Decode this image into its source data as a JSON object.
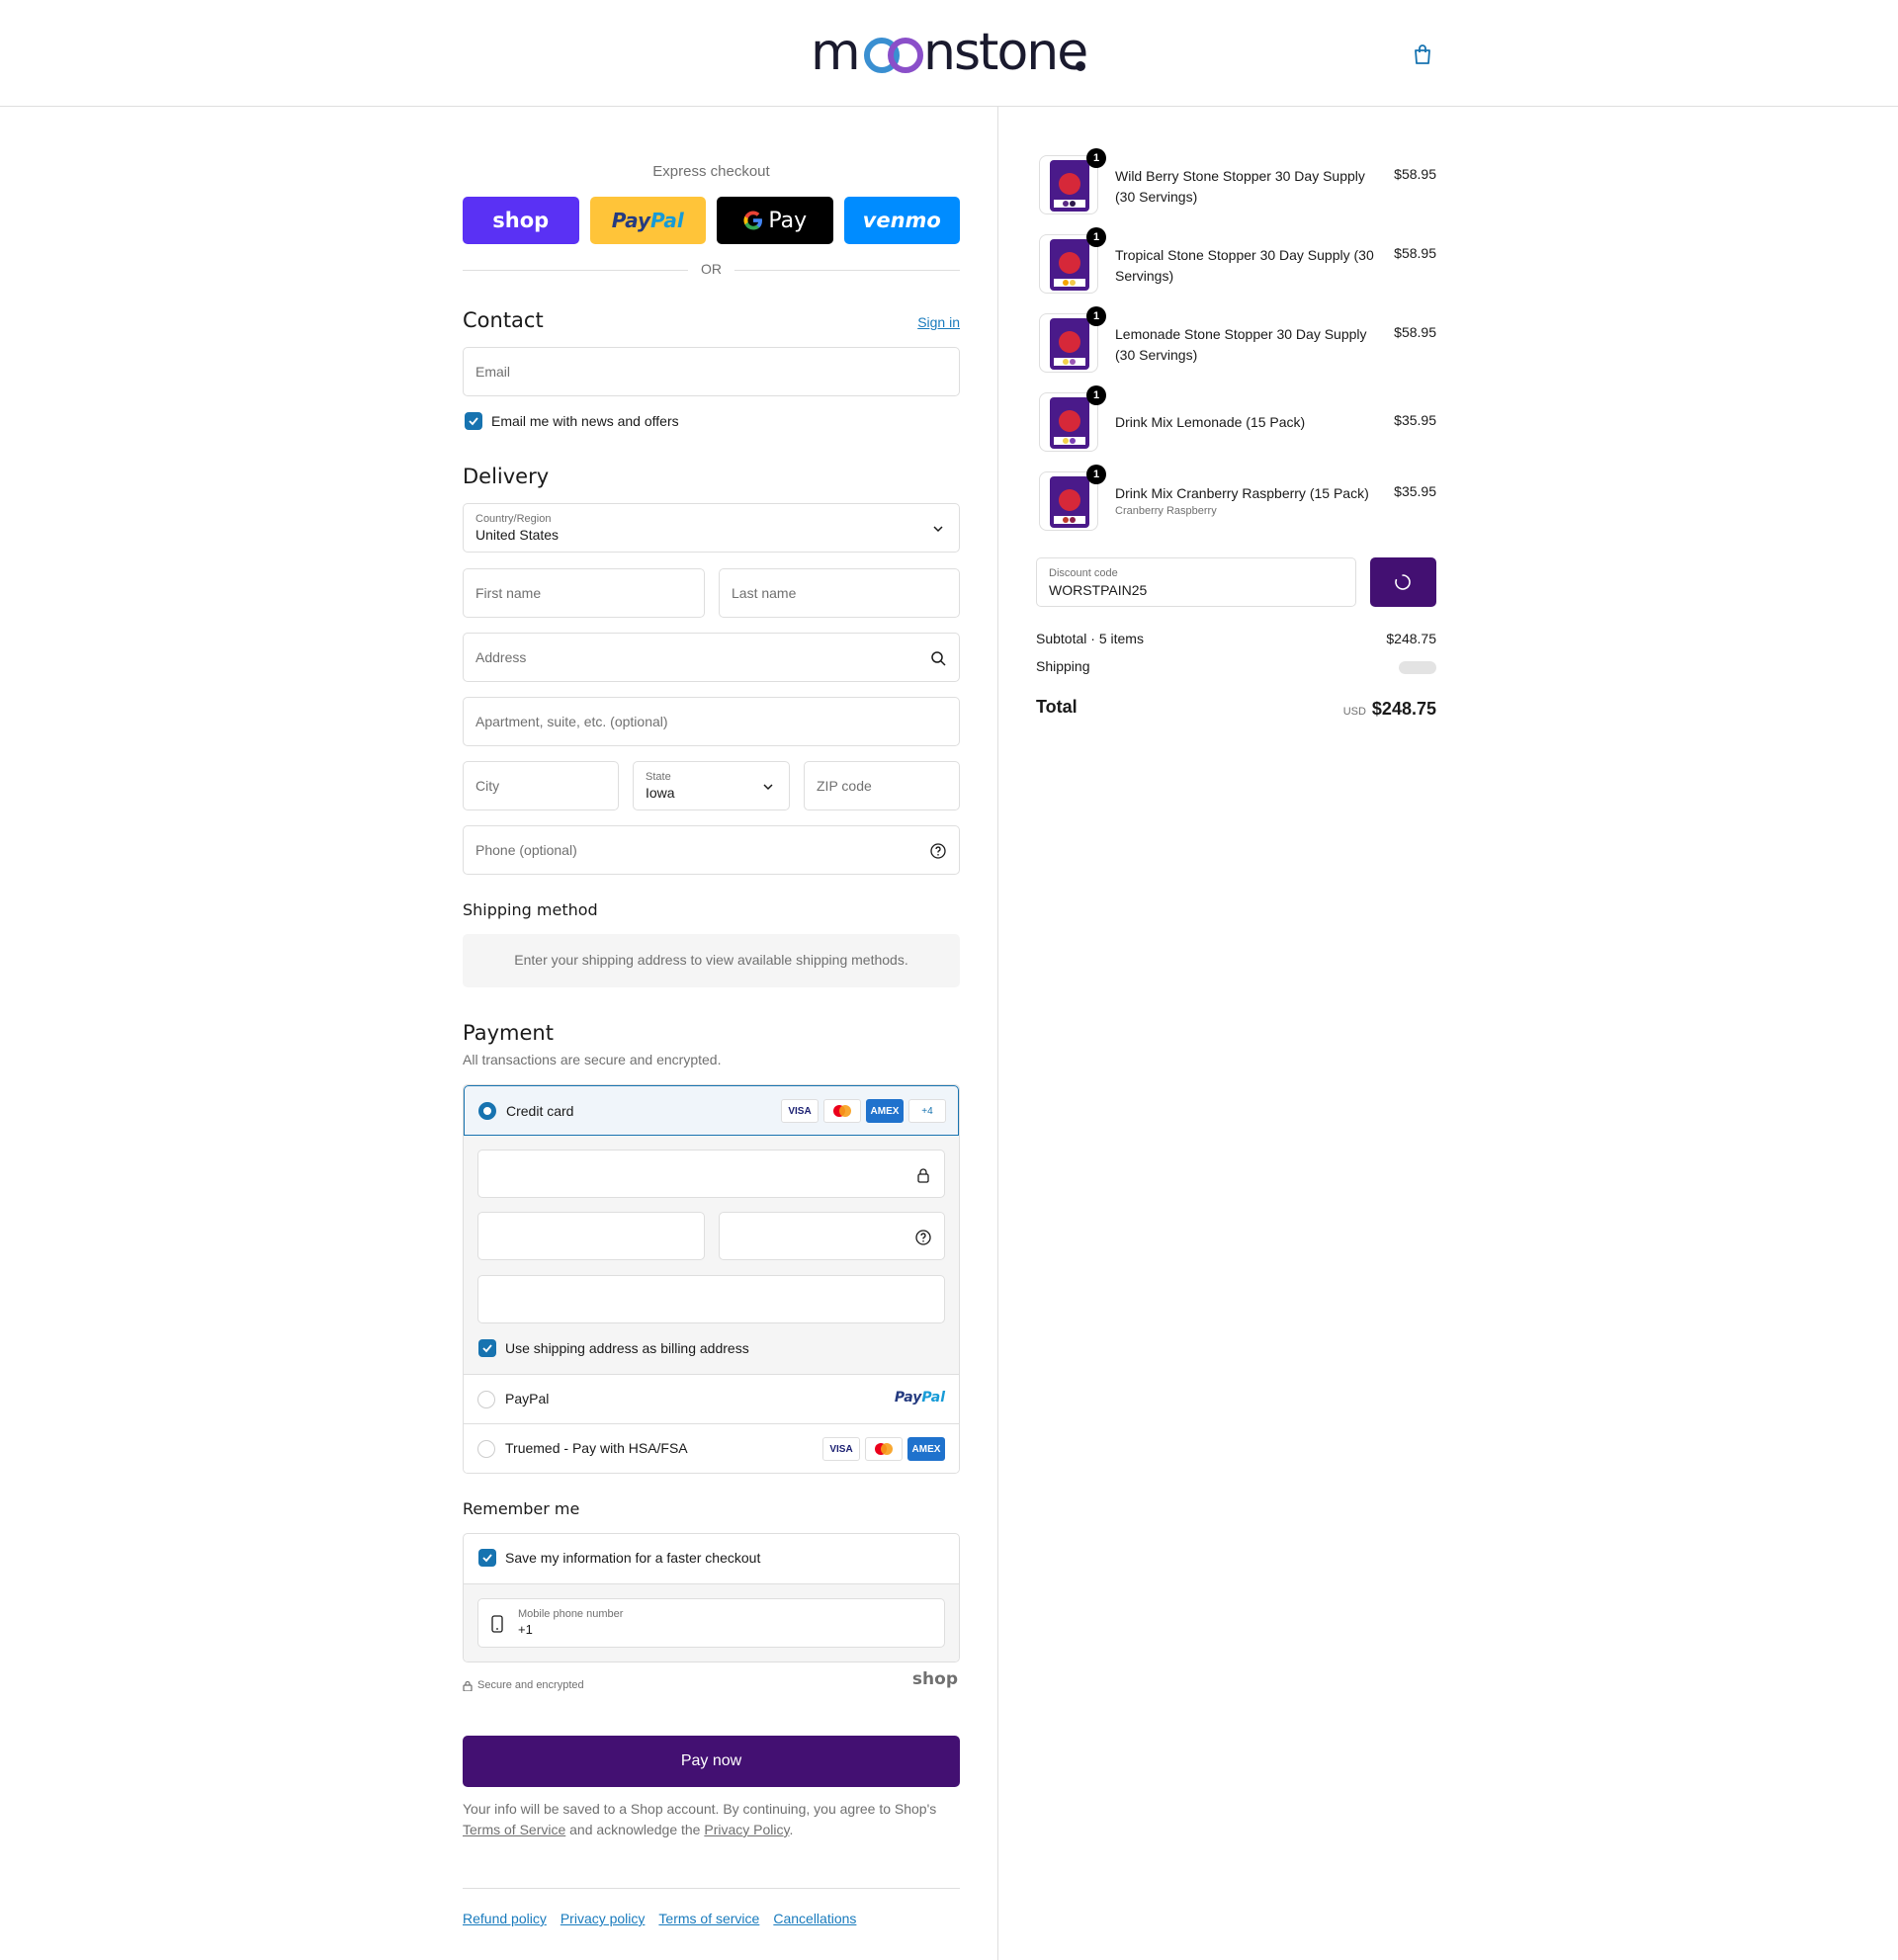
{
  "header": {
    "logo_text": "moonstone."
  },
  "express": {
    "title": "Express checkout",
    "shop": "shop",
    "paypal_a": "Pay",
    "paypal_b": "Pal",
    "gpay": "Pay",
    "venmo": "venmo",
    "or": "OR"
  },
  "contact": {
    "heading": "Contact",
    "sign_in": "Sign in",
    "email_placeholder": "Email",
    "news_label": "Email me with news and offers"
  },
  "delivery": {
    "heading": "Delivery",
    "country_label": "Country/Region",
    "country_value": "United States",
    "first_name": "First name",
    "last_name": "Last name",
    "address": "Address",
    "apartment": "Apartment, suite, etc. (optional)",
    "city": "City",
    "state_label": "State",
    "state_value": "Iowa",
    "zip": "ZIP code",
    "phone": "Phone (optional)"
  },
  "shipping_method": {
    "heading": "Shipping method",
    "message": "Enter your shipping address to view available shipping methods."
  },
  "payment": {
    "heading": "Payment",
    "subtitle": "All transactions are secure and encrypted.",
    "credit_card": "Credit card",
    "more_cards": "+4",
    "billing_label": "Use shipping address as billing address",
    "paypal": "PayPal",
    "paypal_logo_a": "Pay",
    "paypal_logo_b": "Pal",
    "truemed": "Truemed - Pay with HSA/FSA",
    "visa": "VISA",
    "amex": "AMEX"
  },
  "remember": {
    "heading": "Remember me",
    "save_label": "Save my information for a faster checkout",
    "mobile_label": "Mobile phone number",
    "mobile_value": "+1",
    "secure": "Secure and encrypted",
    "shop": "shop"
  },
  "pay_now": "Pay now",
  "legal": {
    "text1": "Your info will be saved to a Shop account. By continuing, you agree to Shop's ",
    "terms": "Terms of Service",
    "text2": " and acknowledge the ",
    "privacy": "Privacy Policy",
    "text3": "."
  },
  "footer": {
    "links": [
      "Refund policy",
      "Privacy policy",
      "Terms of service",
      "Cancellations"
    ]
  },
  "summary": {
    "items": [
      {
        "qty": "1",
        "name": "Wild Berry Stone Stopper 30 Day Supply (30 Servings)",
        "price": "$58.95",
        "variant": ""
      },
      {
        "qty": "1",
        "name": "Tropical Stone Stopper 30 Day Supply (30 Servings)",
        "price": "$58.95",
        "variant": ""
      },
      {
        "qty": "1",
        "name": "Lemonade Stone Stopper 30 Day Supply (30 Servings)",
        "price": "$58.95",
        "variant": ""
      },
      {
        "qty": "1",
        "name": "Drink Mix Lemonade (15 Pack)",
        "price": "$35.95",
        "variant": ""
      },
      {
        "qty": "1",
        "name": "Drink Mix Cranberry Raspberry (15 Pack)",
        "price": "$35.95",
        "variant": "Cranberry Raspberry"
      }
    ],
    "discount_label": "Discount code",
    "discount_value": "WORSTPAIN25",
    "subtotal_label": "Subtotal · 5 items",
    "subtotal_value": "$248.75",
    "shipping_label": "Shipping",
    "total_label": "Total",
    "currency": "USD",
    "total_value": "$248.75"
  },
  "colors": {
    "accent": "#1773b0",
    "brand": "#431072"
  }
}
